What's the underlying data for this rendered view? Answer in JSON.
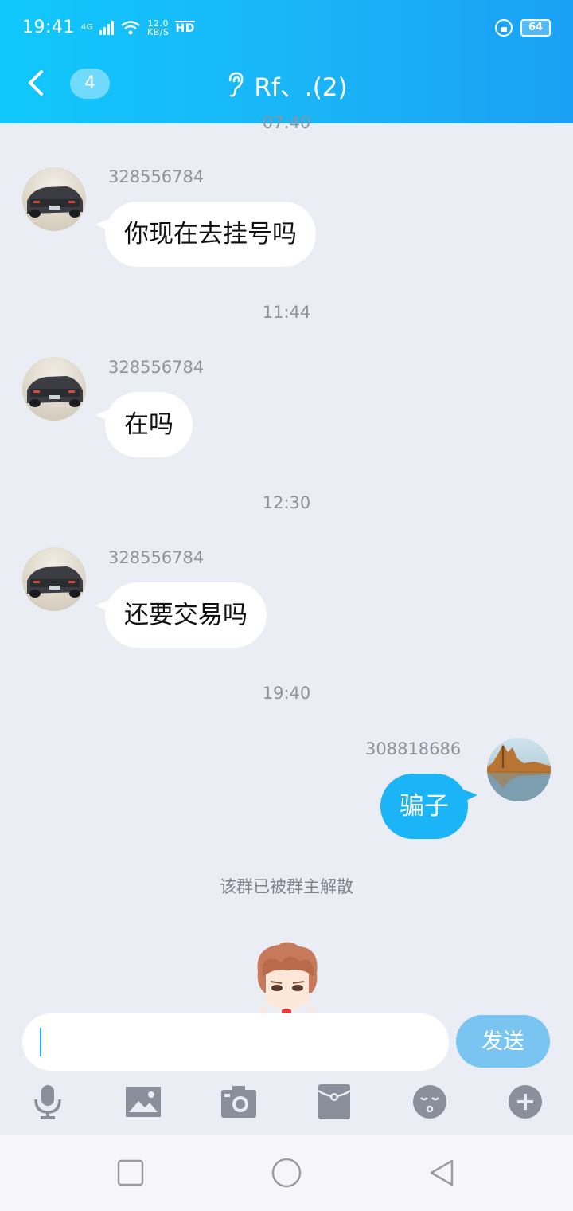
{
  "status_bar": {
    "time": "19:41",
    "network": "4G",
    "speed_value": "12.0",
    "speed_unit": "KB/S",
    "hd": "HD",
    "battery": "64"
  },
  "header": {
    "unread_count": "4",
    "title": "Rf、.(2)"
  },
  "messages": {
    "time_top": "07:40",
    "m1": {
      "user": "328556784",
      "text": "你现在去挂号吗"
    },
    "time_2": "11:44",
    "m2": {
      "user": "328556784",
      "text": "在吗"
    },
    "time_3": "12:30",
    "m3": {
      "user": "328556784",
      "text": "还要交易吗"
    },
    "time_4": "19:40",
    "m4": {
      "user": "308818686",
      "text": "骗子"
    },
    "system_notice": "该群已被群主解散"
  },
  "input": {
    "value": "",
    "send_label": "发送"
  },
  "toolbar": {
    "icons": [
      "microphone-icon",
      "image-icon",
      "camera-icon",
      "red-packet-icon",
      "emoji-icon",
      "plus-icon"
    ]
  },
  "colors": {
    "header_gradient_start": "#10c8fb",
    "header_gradient_end": "#1aa0f4",
    "bubble_self": "#1ab4f7",
    "send_button": "#7ac4f2",
    "background": "#ebedf5"
  }
}
